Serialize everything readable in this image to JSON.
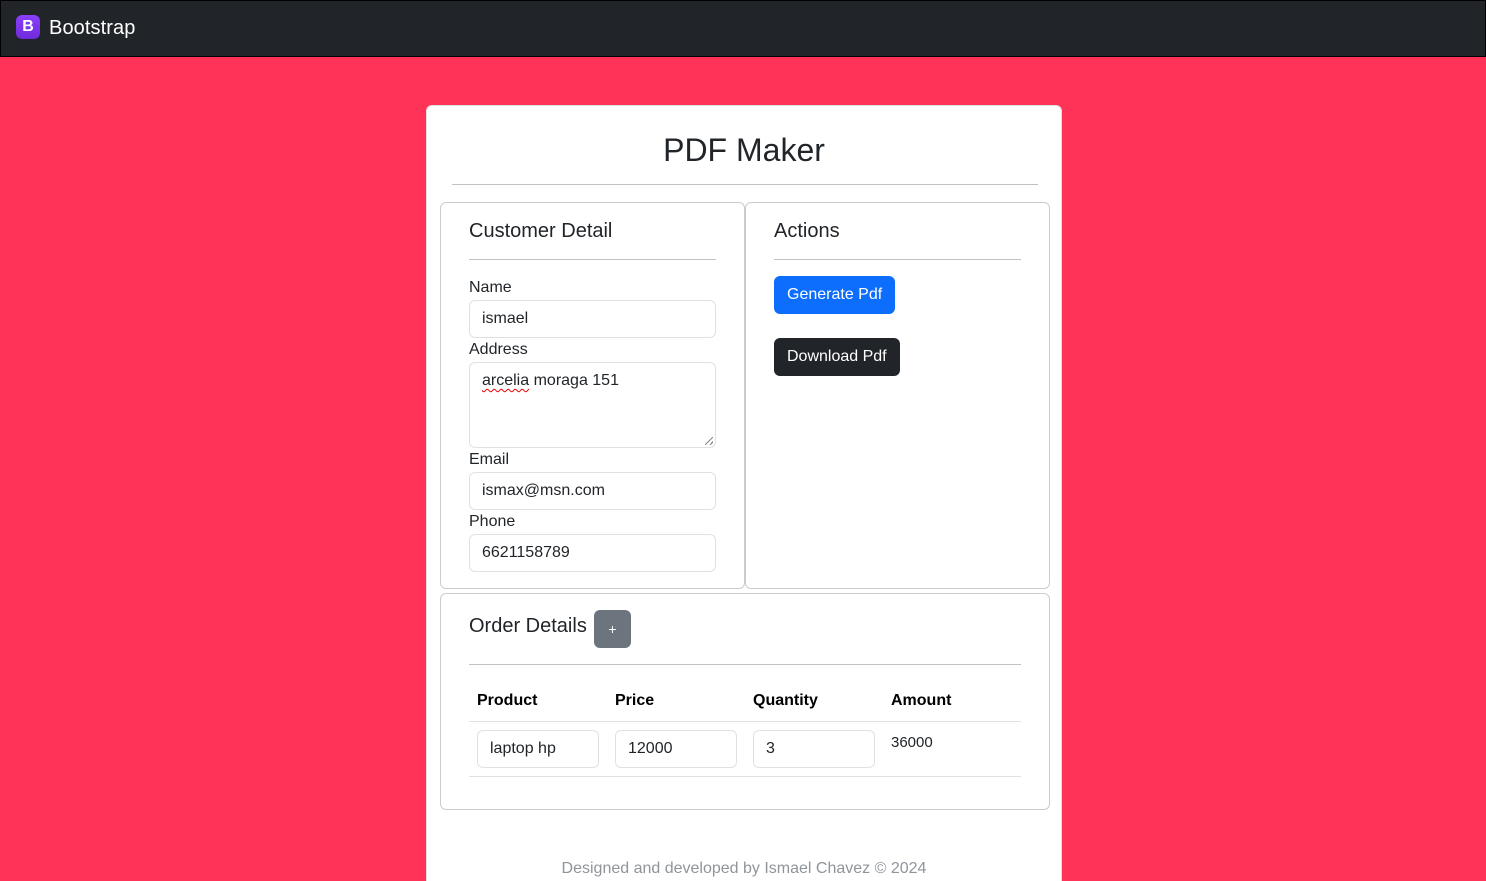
{
  "navbar": {
    "logo_letter": "B",
    "brand": "Bootstrap"
  },
  "page": {
    "title": "PDF Maker",
    "footer": "Designed and developed by Ismael Chavez © 2024"
  },
  "customer": {
    "heading": "Customer Detail",
    "name_label": "Name",
    "name_value": "ismael",
    "address_label": "Address",
    "address_value_word1": "arcelia",
    "address_value_rest": " moraga 151",
    "email_label": "Email",
    "email_value": "ismax@msn.com",
    "phone_label": "Phone",
    "phone_value": "6621158789"
  },
  "actions": {
    "heading": "Actions",
    "generate_label": "Generate Pdf",
    "download_label": "Download Pdf"
  },
  "order": {
    "heading": "Order Details",
    "add_label": "+",
    "columns": [
      "Product",
      "Price",
      "Quantity",
      "Amount"
    ],
    "rows": [
      {
        "product": "laptop hp",
        "price": "12000",
        "quantity": "3",
        "amount": "36000"
      }
    ]
  },
  "colors": {
    "page_background": "#ff3358",
    "navbar": "#212529",
    "primary": "#0d6efd",
    "dark": "#212529",
    "secondary": "#6c757d"
  }
}
